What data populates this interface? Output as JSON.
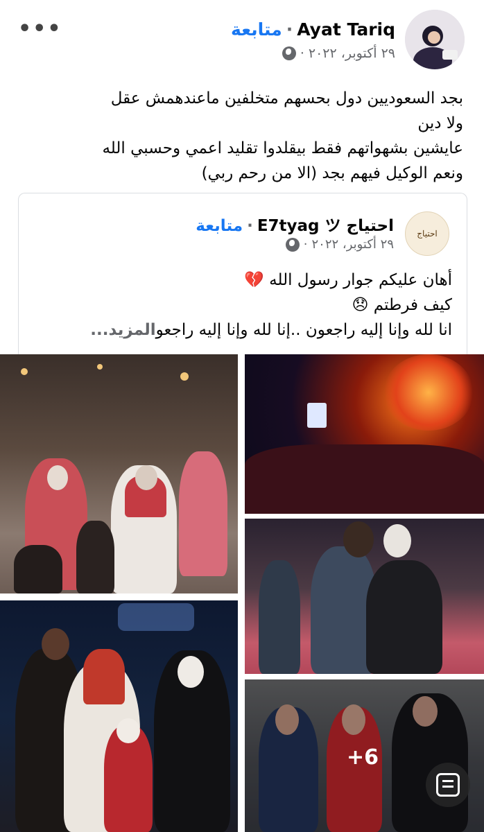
{
  "post": {
    "author": "Ayat Tariq",
    "follow_label": "متابعة",
    "separator": "·",
    "date": "٢٩ أكتوبر، ٢٠٢٢",
    "meta_dot": "·",
    "privacy_icon": "globe-icon",
    "more_icon": "more-options-icon",
    "more_label": "•••",
    "text_lines": [
      "بجد السعوديين دول بحسهم متخلفين  ماعندهمش عقل",
      "ولا دين",
      "عايشين بشهواتهم فقط بيقلدوا تقليد اعمي وحسبي الله",
      "ونعم الوكيل فيهم بجد (الا من رحم ربي)"
    ]
  },
  "shared": {
    "author": "احتياج E7tyag ツ",
    "avatar_text": "احتياج",
    "follow_label": "متابعة",
    "separator": "·",
    "date": "٢٩ أكتوبر، ٢٠٢٢",
    "meta_dot": "·",
    "privacy_icon": "globe-icon",
    "text_lines": [
      "أهان عليكم جوار رسول الله 💔",
      "كيف فرطتم 😞",
      "انا لله وإنا إليه راجعون ..إنا لله وإنا إليه راجعو"
    ],
    "see_more": "المزيد..."
  },
  "photos": {
    "extra_count": "+6",
    "scan_icon": "text-scan-icon"
  },
  "colors": {
    "accent": "#1877f2",
    "secondary_text": "#65676b",
    "text": "#050505"
  }
}
